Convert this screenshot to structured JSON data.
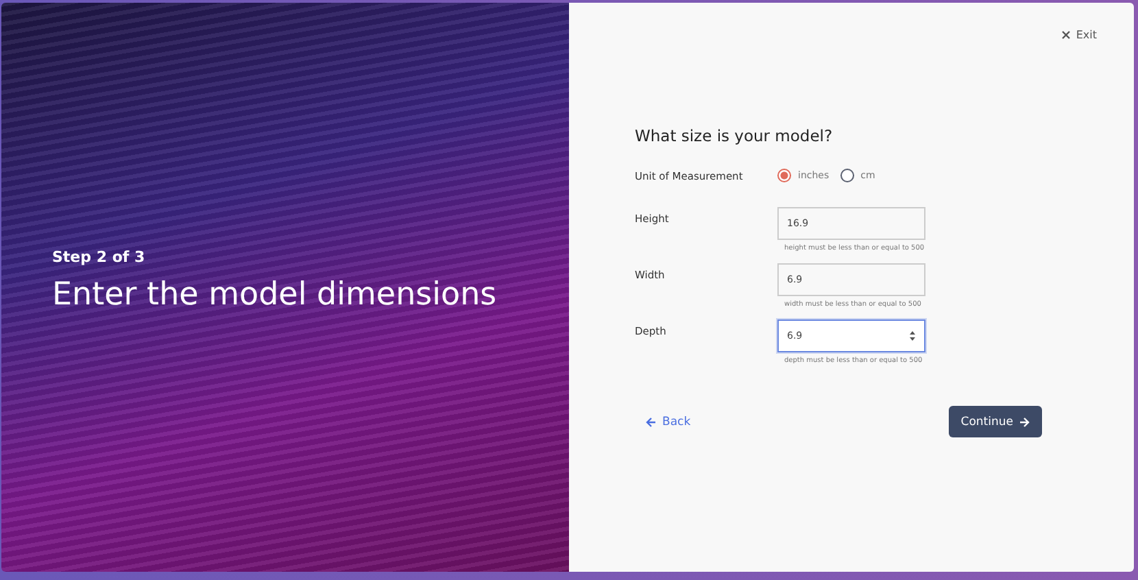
{
  "hero": {
    "step": "Step 2 of 3",
    "title": "Enter the model dimensions"
  },
  "exit": {
    "label": "Exit"
  },
  "form": {
    "title": "What size is your model?",
    "unit": {
      "label": "Unit of Measurement",
      "options": [
        {
          "label": "inches",
          "selected": true
        },
        {
          "label": "cm",
          "selected": false
        }
      ]
    },
    "fields": [
      {
        "label": "Height",
        "value": "16.9",
        "hint": "height must be less than or equal to 500",
        "focused": false
      },
      {
        "label": "Width",
        "value": "6.9",
        "hint": "width must be less than or equal to 500",
        "focused": false
      },
      {
        "label": "Depth",
        "value": "6.9",
        "hint": "depth must be less than or equal to 500",
        "focused": true
      }
    ]
  },
  "back": {
    "label": "Back"
  },
  "continue": {
    "label": "Continue"
  }
}
